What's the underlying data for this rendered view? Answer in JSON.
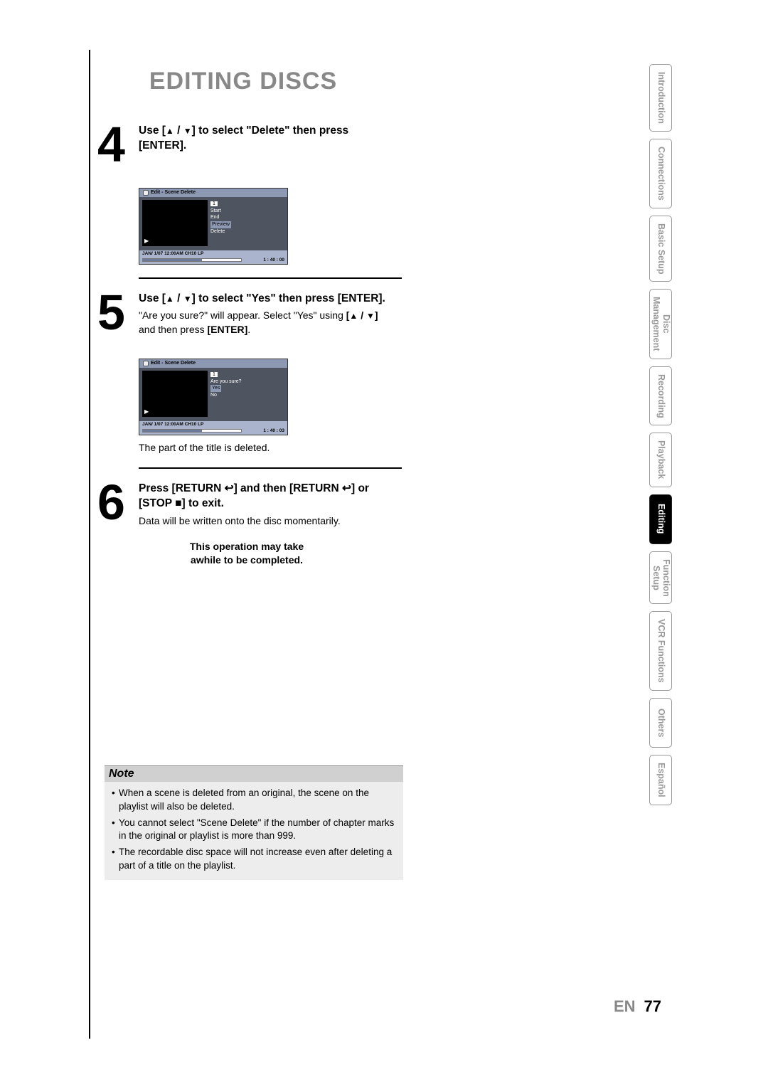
{
  "page_title": "EDITING DISCS",
  "steps": {
    "s4": {
      "num": "4",
      "head_pre": "Use [",
      "head_mid": "] to select \"Delete\" then press [ENTER].",
      "screen": {
        "title": "Edit - Scene Delete",
        "item_num": "1",
        "items": [
          "Start",
          "End",
          "Preview",
          "Delete"
        ],
        "highlight_index": 2,
        "footer": "JAN/ 1/07 12:00AM CH10   LP",
        "time": "1 : 40 : 00"
      }
    },
    "s5": {
      "num": "5",
      "head_pre": "Use [",
      "head_mid": "] to select \"Yes\" then press [ENTER].",
      "desc_pre": "\"Are you sure?\" will appear. Select \"Yes\" using ",
      "desc_key_pre": "[",
      "desc_key_post": "]",
      "desc_post": " and then press ",
      "desc_enter": "[ENTER]",
      "desc_end": ".",
      "screen": {
        "title": "Edit - Scene Delete",
        "item_num": "1",
        "items": [
          "Are you sure?",
          "Yes",
          "No"
        ],
        "highlight_index": 1,
        "footer": "JAN/ 1/07 12:00AM CH10   LP",
        "time": "1 : 40 : 03"
      },
      "after": "The part of the title is deleted."
    },
    "s6": {
      "num": "6",
      "head_a": "Press [RETURN ",
      "head_b": "] and then [RETURN ",
      "head_c": "] or [STOP ",
      "head_d": "] to exit.",
      "desc": "Data will be written onto the disc momentarily.",
      "note_l1": "This operation may take",
      "note_l2": "awhile to be completed."
    }
  },
  "note": {
    "title": "Note",
    "items": [
      "When a scene is deleted from an original, the scene on the playlist will also be deleted.",
      "You cannot select \"Scene Delete\" if the number of chapter marks in the original or playlist is more than 999.",
      "The recordable disc space will not increase even after deleting a part of a title on the playlist."
    ]
  },
  "tabs": [
    "Introduction",
    "Connections",
    "Basic Setup",
    "Disc\nManagement",
    "Recording",
    "Playback",
    "Editing",
    "Function\nSetup",
    "VCR Functions",
    "Others",
    "Español"
  ],
  "active_tab": "Editing",
  "footer": {
    "lang": "EN",
    "page": "77"
  },
  "glyphs": {
    "up": "▲",
    "down": "▼",
    "return": "↩",
    "stop": "■",
    "slash": " / "
  }
}
